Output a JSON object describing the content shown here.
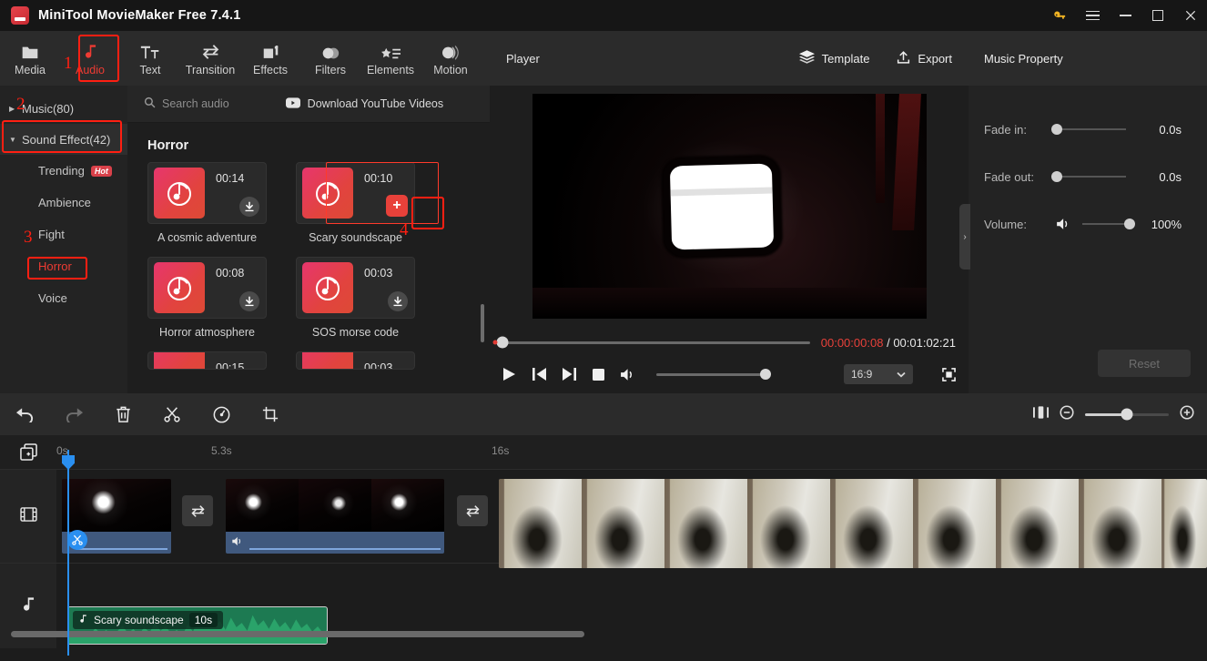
{
  "window": {
    "title": "MiniTool MovieMaker Free 7.4.1",
    "logo_icon": "minitool-logo-icon",
    "controls": {
      "key_icon": "key-icon",
      "menu_icon": "hamburger-menu-icon",
      "minimize_icon": "minimize-icon",
      "maximize_icon": "maximize-icon",
      "close_icon": "close-icon"
    }
  },
  "ribbon": {
    "items": [
      {
        "label": "Media",
        "icon": "folder-icon",
        "active": false
      },
      {
        "label": "Audio",
        "icon": "music-note-icon",
        "active": true
      },
      {
        "label": "Text",
        "icon": "text-icon",
        "active": false
      },
      {
        "label": "Transition",
        "icon": "transition-icon",
        "active": false
      },
      {
        "label": "Effects",
        "icon": "effects-icon",
        "active": false
      },
      {
        "label": "Filters",
        "icon": "filters-icon",
        "active": false
      },
      {
        "label": "Elements",
        "icon": "elements-icon",
        "active": false
      },
      {
        "label": "Motion",
        "icon": "motion-icon",
        "active": false
      }
    ]
  },
  "sidebar": {
    "groups": [
      {
        "label": "Music(80)",
        "expanded": false,
        "chevron": "chevron-right-icon"
      },
      {
        "label": "Sound Effect(42)",
        "expanded": true,
        "chevron": "chevron-down-icon"
      }
    ],
    "subitems": [
      {
        "label": "Trending",
        "badge": "Hot",
        "active": false
      },
      {
        "label": "Ambience",
        "badge": "",
        "active": false
      },
      {
        "label": "Fight",
        "badge": "",
        "active": false
      },
      {
        "label": "Horror",
        "badge": "",
        "active": true
      },
      {
        "label": "Voice",
        "badge": "",
        "active": false
      }
    ]
  },
  "audio_list": {
    "search_placeholder": "Search audio",
    "search_icon": "search-icon",
    "download_youtube_label": "Download YouTube Videos",
    "download_youtube_icon": "youtube-download-icon",
    "section_title": "Horror",
    "cards": [
      {
        "name": "A cosmic adventure",
        "duration": "00:14",
        "action": "download",
        "selected": false
      },
      {
        "name": "Scary soundscape",
        "duration": "00:10",
        "action": "add",
        "selected": true
      },
      {
        "name": "Horror atmosphere",
        "duration": "00:08",
        "action": "download",
        "selected": false
      },
      {
        "name": "SOS morse code",
        "duration": "00:03",
        "action": "download",
        "selected": false
      }
    ],
    "partial_cards": [
      {
        "duration": "00:15"
      },
      {
        "duration": "00:03"
      }
    ]
  },
  "player": {
    "title": "Player",
    "template_label": "Template",
    "template_icon": "layers-icon",
    "export_label": "Export",
    "export_icon": "upload-icon",
    "current_time": "00:00:00:08",
    "separator": "/",
    "total_time": "00:01:02:21",
    "controls": {
      "play_icon": "play-icon",
      "prev_icon": "previous-frame-icon",
      "next_icon": "next-frame-icon",
      "stop_icon": "stop-icon",
      "volume_icon": "volume-icon"
    },
    "aspect_ratio": "16:9",
    "aspect_chevron": "chevron-down-icon",
    "fullscreen_icon": "fullscreen-icon"
  },
  "property_panel": {
    "title": "Music Property",
    "rows": [
      {
        "label": "Fade in:",
        "value": "0.0s",
        "knob_pct": 0
      },
      {
        "label": "Fade out:",
        "value": "0.0s",
        "knob_pct": 0
      },
      {
        "label": "Volume:",
        "value": "100%",
        "knob_pct": 100,
        "icon": "volume-icon"
      }
    ],
    "reset_label": "Reset",
    "collapse_icon": "chevron-right-icon"
  },
  "timeline": {
    "toolbar": [
      {
        "icon": "undo-icon",
        "name": "undo-button",
        "dim": false
      },
      {
        "icon": "redo-icon",
        "name": "redo-button",
        "dim": true
      },
      {
        "icon": "delete-icon",
        "name": "delete-button",
        "dim": false
      },
      {
        "icon": "split-icon",
        "name": "split-button",
        "dim": false
      },
      {
        "icon": "speed-icon",
        "name": "speed-button",
        "dim": false
      },
      {
        "icon": "crop-icon",
        "name": "crop-button",
        "dim": false
      }
    ],
    "zoom": {
      "fit_icon": "fit-to-timeline-icon",
      "minus_icon": "zoom-out-icon",
      "plus_icon": "zoom-in-icon"
    },
    "add_media_icon": "add-media-icon",
    "ruler_labels": [
      "0s",
      "5.3s",
      "16s"
    ],
    "tracks": [
      {
        "type": "video",
        "icon": "film-icon"
      },
      {
        "type": "audio",
        "icon": "music-note-icon"
      }
    ],
    "video_clips": [
      {
        "index": 1,
        "selected_badge": "split-icon",
        "has_audio_strip": true
      },
      {
        "index": 2,
        "audio_icon": "volume-icon",
        "has_audio_strip": true
      },
      {
        "index": 3,
        "has_audio_strip": false
      }
    ],
    "transition_icon": "transition-icon",
    "audio_clip": {
      "icon": "music-note-icon",
      "name": "Scary soundscape",
      "duration": "10s"
    }
  },
  "annotations": [
    {
      "number": "1",
      "target": "audio-ribbon-tab"
    },
    {
      "number": "2",
      "target": "sound-effect-group"
    },
    {
      "number": "3",
      "target": "horror-subcategory"
    },
    {
      "number": "4",
      "target": "scary-soundscape-add-button"
    }
  ],
  "colors": {
    "accent_red": "#ee3b33",
    "annotation_red": "#ff1f12",
    "playhead_blue": "#2a8ff0",
    "audio_clip_green": "#1d7a52"
  }
}
